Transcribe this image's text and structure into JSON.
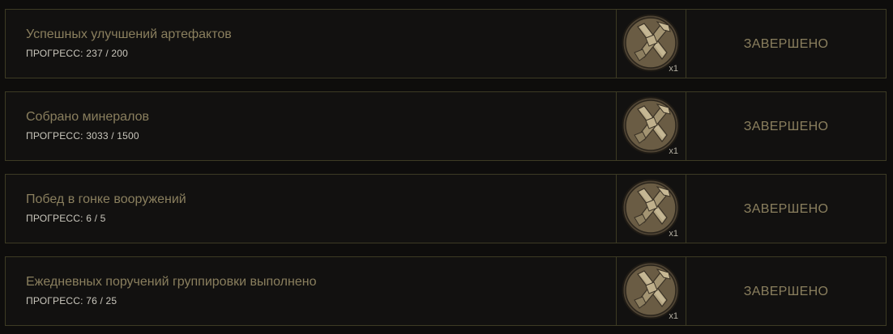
{
  "colors": {
    "background": "#0e0d0c",
    "row_background": "#121110",
    "border": "#3d3b24",
    "title_text": "#8a7f5e",
    "progress_text": "#c9c6bc",
    "status_text": "#8a7f5e",
    "coin": "#6a5c44"
  },
  "reward_icon": "crossed-tools-coin-icon",
  "achievements": [
    {
      "title": "Успешных улучшений артефактов",
      "progress_label": "ПРОГРЕСС: 237 / 200",
      "reward_qty": "x1",
      "status": "ЗАВЕРШЕНО"
    },
    {
      "title": "Собрано минералов",
      "progress_label": "ПРОГРЕСС: 3033 / 1500",
      "reward_qty": "x1",
      "status": "ЗАВЕРШЕНО"
    },
    {
      "title": "Побед в гонке вооружений",
      "progress_label": "ПРОГРЕСС: 6 / 5",
      "reward_qty": "x1",
      "status": "ЗАВЕРШЕНО"
    },
    {
      "title": "Ежедневных поручений группировки выполнено",
      "progress_label": "ПРОГРЕСС: 76 / 25",
      "reward_qty": "x1",
      "status": "ЗАВЕРШЕНО"
    }
  ]
}
